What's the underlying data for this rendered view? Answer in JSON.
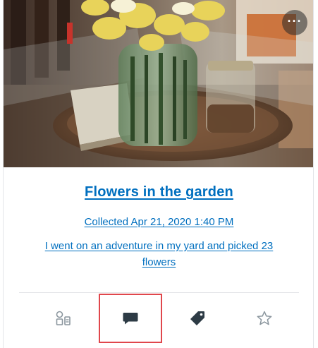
{
  "card": {
    "title": "Flowers in the garden",
    "collected": "Collected Apr 21, 2020 1:40 PM",
    "description": "I went on an adventure in my yard and picked 23 flowers",
    "more_label": "···"
  },
  "toolbar": {
    "items": [
      {
        "icon": "rubric-icon",
        "selected": false
      },
      {
        "icon": "comment-icon",
        "selected": true
      },
      {
        "icon": "tag-icon",
        "selected": false
      },
      {
        "icon": "star-icon",
        "selected": false
      }
    ]
  },
  "colors": {
    "link": "#006fbf",
    "icon_dark": "#2d3b45",
    "icon_light": "#8b969e",
    "highlight": "#e0474c"
  }
}
